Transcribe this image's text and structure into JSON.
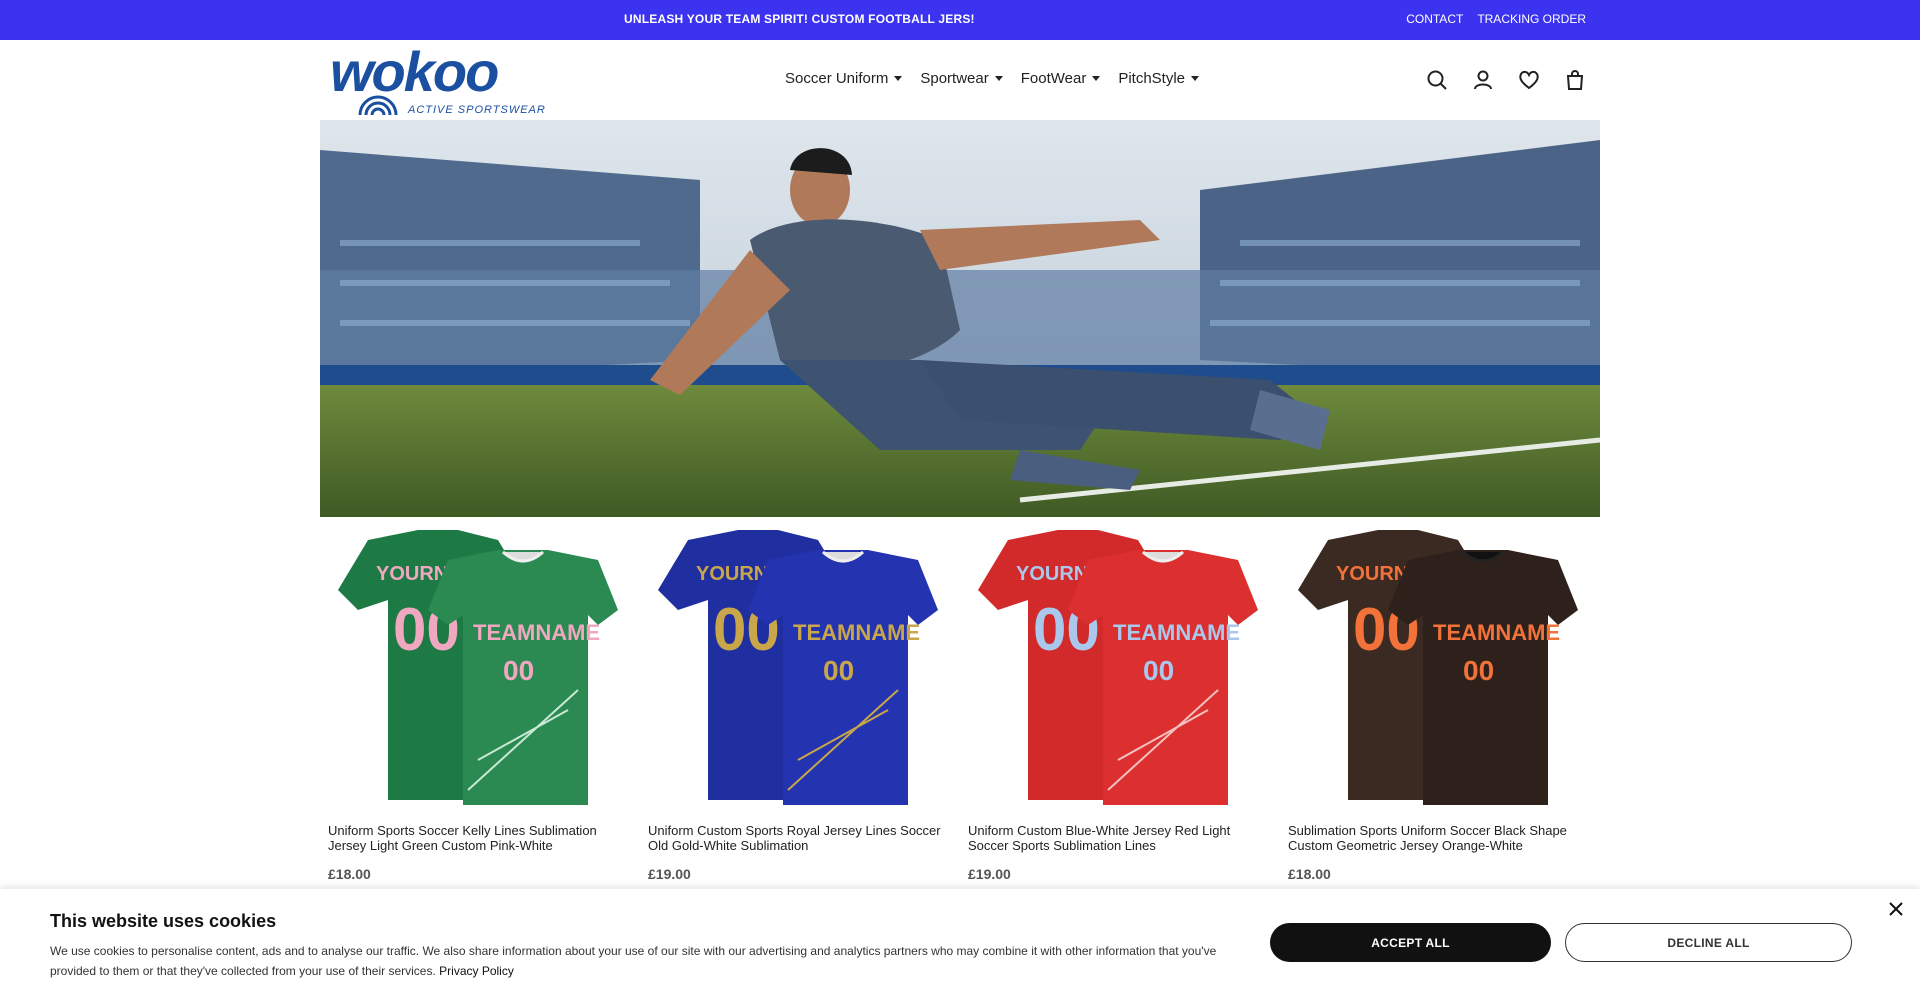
{
  "announcement": "UNLEASH YOUR TEAM SPIRIT! CUSTOM FOOTBALL JERS!",
  "toplinks": {
    "contact": "CONTACT",
    "tracking": "TRACKING ORDER"
  },
  "logo": {
    "wordmark": "wokoo",
    "tagline": "ACTIVE SPORTSWEAR"
  },
  "nav": [
    {
      "label": "Soccer Uniform"
    },
    {
      "label": "Sportwear"
    },
    {
      "label": "FootWear"
    },
    {
      "label": "PitchStyle"
    }
  ],
  "header_icons": [
    "search-icon",
    "account-icon",
    "wishlist-icon",
    "cart-icon"
  ],
  "products": [
    {
      "name": "Uniform Sports Soccer Kelly Lines Sublimation Jersey Light Green Custom Pink-White",
      "price": "£18.00",
      "jersey_text": {
        "back": "YOURNAME",
        "front": "TEAMNAME",
        "number": "00"
      },
      "colors": {
        "shirt": "#1e7a45",
        "accent": "#f0a8c0"
      }
    },
    {
      "name": "Uniform Custom Sports Royal Jersey Lines Soccer Old Gold-White Sublimation",
      "price": "£19.00",
      "jersey_text": {
        "back": "YOURNAME",
        "front": "TEAMNAME",
        "number": "00"
      },
      "colors": {
        "shirt": "#1f2fa0",
        "accent": "#c9a64a"
      }
    },
    {
      "name": "Uniform Custom Blue-White Jersey Red Light Soccer Sports Sublimation Lines",
      "price": "£19.00",
      "jersey_text": {
        "back": "YOURNAME",
        "front": "TEAMNAME",
        "number": "00"
      },
      "colors": {
        "shirt": "#d22a2a",
        "accent": "#a9c8ec"
      }
    },
    {
      "name": "Sublimation Sports Uniform Soccer Black Shape Custom Geometric Jersey Orange-White",
      "price": "£18.00",
      "jersey_text": {
        "back": "YOURNAME",
        "front": "TEAMNAME",
        "number": "00"
      },
      "colors": {
        "shirt": "#3a2a22",
        "accent": "#f2723a"
      }
    }
  ],
  "cookie": {
    "title": "This website uses cookies",
    "text": "We use cookies to personalise content, ads and to analyse our traffic. We also share information about your use of our site with our advertising and analytics partners who may combine it with other information that you've provided to them or that they've collected from your use of their services.",
    "policy_link": "Privacy Policy",
    "accept": "ACCEPT ALL",
    "decline": "DECLINE ALL"
  },
  "colors": {
    "brand": "#3b33f0",
    "logo": "#1b4fa0"
  }
}
